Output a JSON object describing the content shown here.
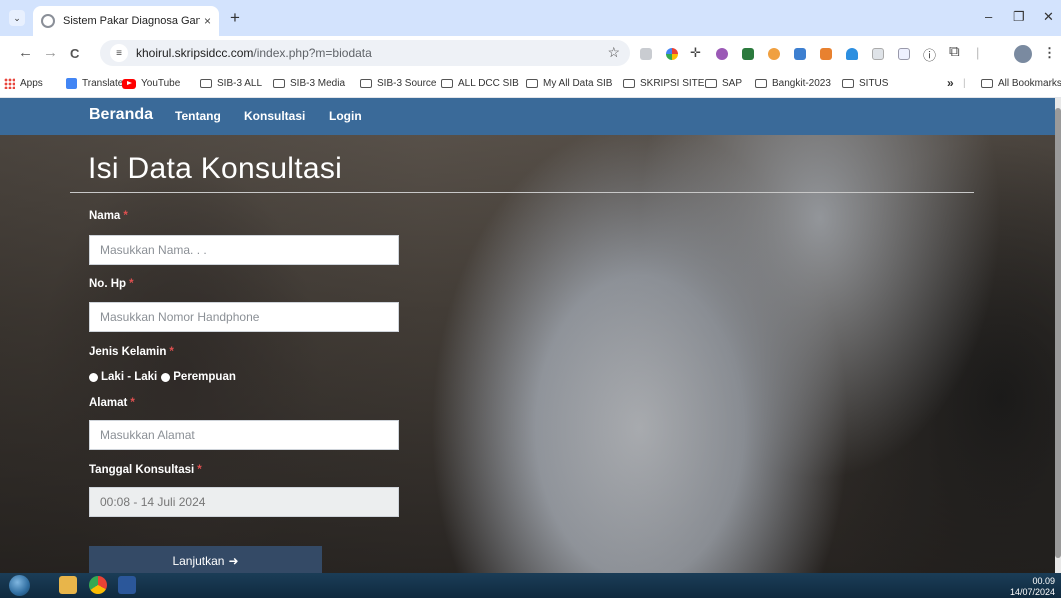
{
  "browser": {
    "tab": {
      "title": "Sistem Pakar Diagnosa Ganggu",
      "close": "×"
    },
    "new_tab": "+",
    "window_controls": {
      "minimize": "–",
      "restore": "❐",
      "close": "✕"
    },
    "nav": {
      "back": "←",
      "forward": "→",
      "reload": "C"
    },
    "url": {
      "host": "khoirul.skripsidcc.com",
      "path": "/index.php?m=biodata"
    },
    "more_menu": "⋮"
  },
  "bookmarks": {
    "apps": "Apps",
    "items": [
      "Translate",
      "YouTube",
      "SIB-3 ALL",
      "SIB-3 Media",
      "SIB-3 Source",
      "ALL DCC SIB",
      "My All Data SIB",
      "SKRIPSI SITE",
      "SAP",
      "Bangkit-2023",
      "SITUS"
    ],
    "overflow": "»",
    "all_bookmarks": "All Bookmarks"
  },
  "navbar": {
    "brand": "Beranda",
    "links": [
      "Tentang",
      "Konsultasi",
      "Login"
    ]
  },
  "form": {
    "title": "Isi Data Konsultasi",
    "required_mark": "*",
    "nama": {
      "label": "Nama",
      "placeholder": "Masukkan Nama. . ."
    },
    "hp": {
      "label": "No. Hp",
      "placeholder": "Masukkan Nomor Handphone"
    },
    "gender": {
      "label": "Jenis Kelamin",
      "options": [
        "Laki - Laki",
        "Perempuan"
      ]
    },
    "alamat": {
      "label": "Alamat",
      "placeholder": "Masukkan Alamat"
    },
    "tanggal": {
      "label": "Tanggal Konsultasi",
      "value": "00:08 - 14 Juli 2024"
    },
    "submit": "Lanjutkan"
  },
  "taskbar": {
    "time": "00.09",
    "date": "14/07/2024"
  },
  "colors": {
    "navbar": "#3a6a99",
    "button": "#344a66",
    "required": "#e05050",
    "tab_strip": "#d3e3fd"
  }
}
